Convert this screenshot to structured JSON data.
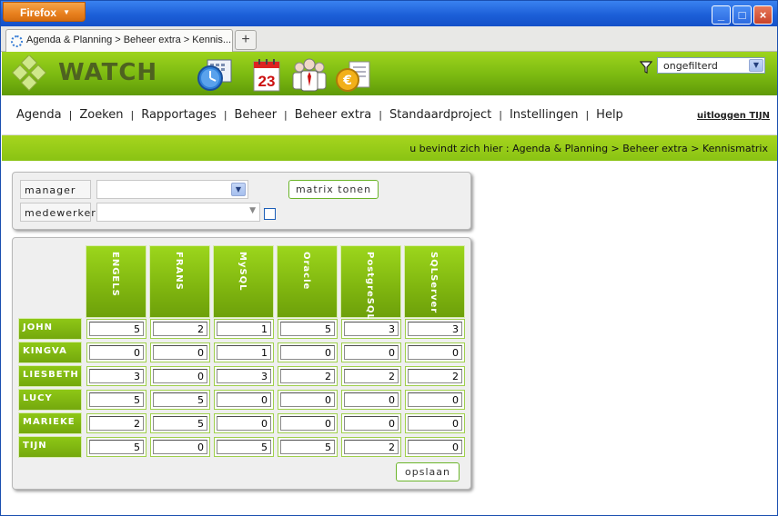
{
  "browser": {
    "app_button": "Firefox",
    "tab_title": "Agenda & Planning > Beheer extra > Kennis...",
    "new_tab": "+",
    "window_buttons": {
      "minimize": "_",
      "maximize": "□",
      "close": "×"
    }
  },
  "header": {
    "logo_text": "WATCH",
    "icons": [
      "clock-calendar-icon",
      "calendar-23-icon",
      "people-icon",
      "euro-icon"
    ],
    "calendar_day": "23",
    "filter": {
      "value": "ongefilterd"
    }
  },
  "menu": {
    "items": [
      "Agenda",
      "Zoeken",
      "Rapportages",
      "Beheer",
      "Beheer extra",
      "Standaardproject",
      "Instellingen",
      "Help"
    ],
    "logout": "uitloggen TIJN"
  },
  "breadcrumb": "u bevindt zich hier : Agenda & Planning > Beheer extra > Kennismatrix",
  "form": {
    "manager_label": "manager",
    "manager_value": "",
    "employee_label": "medewerker",
    "employee_value": "",
    "show_button": "matrix tonen"
  },
  "matrix": {
    "columns": [
      "ENGELS",
      "FRANS",
      "MySQL",
      "Oracle",
      "PostgreSQL",
      "SQLServer"
    ],
    "rows": [
      {
        "name": "JOHN",
        "values": [
          "5",
          "2",
          "1",
          "5",
          "3",
          "3"
        ]
      },
      {
        "name": "KINGVA",
        "values": [
          "0",
          "0",
          "1",
          "0",
          "0",
          "0"
        ]
      },
      {
        "name": "LIESBETH",
        "values": [
          "3",
          "0",
          "3",
          "2",
          "2",
          "2"
        ]
      },
      {
        "name": "LUCY",
        "values": [
          "5",
          "5",
          "0",
          "0",
          "0",
          "0"
        ]
      },
      {
        "name": "MARIEKE",
        "values": [
          "2",
          "5",
          "0",
          "0",
          "0",
          "0"
        ]
      },
      {
        "name": "TIJN",
        "values": [
          "5",
          "0",
          "5",
          "5",
          "2",
          "0"
        ]
      }
    ],
    "save_button": "opslaan"
  },
  "colors": {
    "accent_green": "#8ac313",
    "titlebar_blue": "#1c5fd8",
    "firefox_orange": "#e8801e"
  }
}
